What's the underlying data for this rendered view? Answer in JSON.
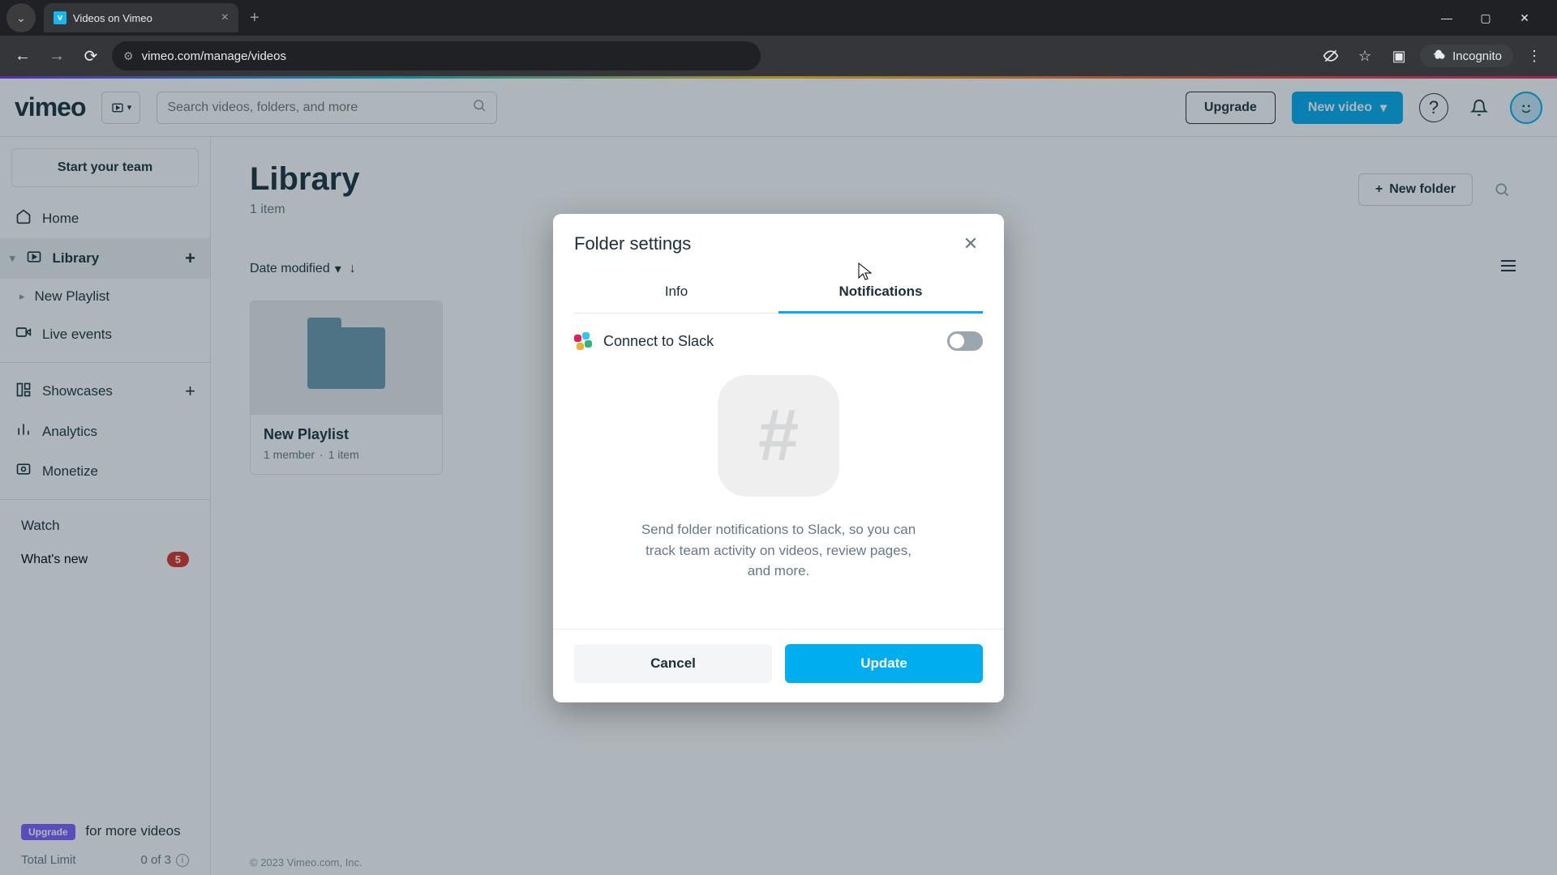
{
  "browser": {
    "tab_title": "Videos on Vimeo",
    "url": "vimeo.com/manage/videos",
    "incognito_label": "Incognito"
  },
  "header": {
    "logo": "vimeo",
    "search_placeholder": "Search videos, folders, and more",
    "upgrade": "Upgrade",
    "new_video": "New video"
  },
  "sidebar": {
    "start_team": "Start your team",
    "home": "Home",
    "library": "Library",
    "new_playlist": "New Playlist",
    "live_events": "Live events",
    "showcases": "Showcases",
    "analytics": "Analytics",
    "monetize": "Monetize",
    "watch": "Watch",
    "whats_new": "What's new",
    "whats_new_count": "5",
    "upgrade_chip": "Upgrade",
    "upgrade_text": "for more videos",
    "total_limit_label": "Total Limit",
    "total_limit_value": "0 of 3"
  },
  "content": {
    "title": "Library",
    "item_count": "1 item",
    "new_folder": "New folder",
    "sort_label": "Date modified",
    "folder": {
      "name": "New Playlist",
      "members": "1 member",
      "items": "1 item"
    },
    "footer": "© 2023 Vimeo.com, Inc."
  },
  "modal": {
    "title": "Folder settings",
    "tab_info": "Info",
    "tab_notif": "Notifications",
    "slack_label": "Connect to Slack",
    "description": "Send folder notifications to Slack, so you can track team activity on videos, review pages, and more.",
    "cancel": "Cancel",
    "update": "Update"
  }
}
